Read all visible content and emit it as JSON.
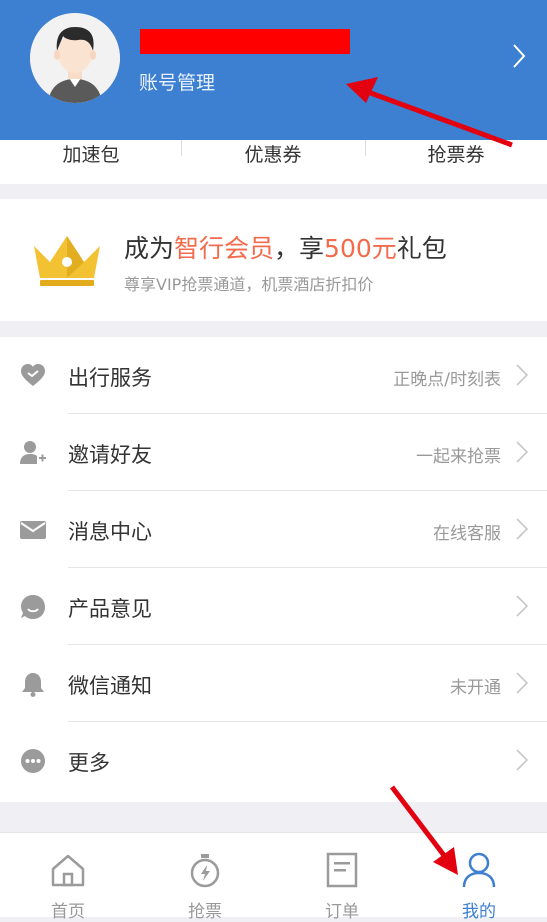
{
  "header": {
    "account_label": "账号管理"
  },
  "tabs": [
    {
      "label": "加速包"
    },
    {
      "label": "优惠券"
    },
    {
      "label": "抢票券"
    }
  ],
  "member": {
    "title_prefix": "成为",
    "title_highlight1": "智行会员",
    "title_mid": "，享",
    "title_highlight2": "500元",
    "title_suffix": "礼包",
    "subtitle": "尊享VIP抢票通道，机票酒店折扣价"
  },
  "menu": [
    {
      "label": "出行服务",
      "value": "正晚点/时刻表",
      "icon": "heart-icon"
    },
    {
      "label": "邀请好友",
      "value": "一起来抢票",
      "icon": "user-add-icon"
    },
    {
      "label": "消息中心",
      "value": "在线客服",
      "icon": "mail-icon"
    },
    {
      "label": "产品意见",
      "value": "",
      "icon": "feedback-icon"
    },
    {
      "label": "微信通知",
      "value": "未开通",
      "icon": "bell-icon"
    },
    {
      "label": "更多",
      "value": "",
      "icon": "more-icon"
    }
  ],
  "tabbar": [
    {
      "label": "首页",
      "icon": "home-icon"
    },
    {
      "label": "抢票",
      "icon": "stopwatch-icon"
    },
    {
      "label": "订单",
      "icon": "order-icon"
    },
    {
      "label": "我的",
      "icon": "profile-icon"
    }
  ],
  "colors": {
    "brand": "#3d7fd1",
    "highlight": "#f36b4b",
    "annotation": "#e3000f"
  }
}
